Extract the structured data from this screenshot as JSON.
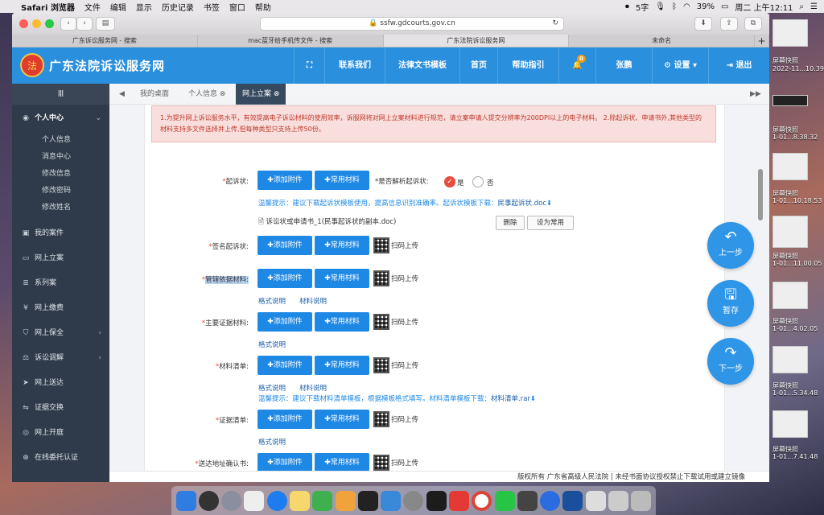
{
  "menubar": {
    "app": "Safari 浏览器",
    "items": [
      "文件",
      "编辑",
      "显示",
      "历史记录",
      "书签",
      "窗口",
      "帮助"
    ],
    "input_method": "5字",
    "battery": "39%",
    "clock": "周二 上午12:11"
  },
  "browser": {
    "url": "ssfw.gdcourts.gov.cn",
    "tabs": [
      {
        "label": "广东诉讼服务网 - 搜索"
      },
      {
        "label": "mac蓝牙给手机传文件 - 搜索"
      },
      {
        "label": "广东法院诉讼服务网"
      },
      {
        "label": "未命名"
      }
    ]
  },
  "site": {
    "title": "广东法院诉讼服务网",
    "logo_glyph": "法",
    "nav": {
      "expand": "⛶",
      "contact": "联系我们",
      "templates": "法律文书模板",
      "home": "首页",
      "help": "帮助指引",
      "bell_badge": "0",
      "user": "张鹏",
      "settings": "设置",
      "logout": "退出"
    }
  },
  "sidebar": {
    "menu_icon": "Ⅲ",
    "personal_center": "个人中心",
    "sub_items": [
      "个人信息",
      "消息中心",
      "修改信息",
      "修改密码",
      "修改姓名"
    ],
    "items": [
      "我的案件",
      "网上立案",
      "系列案",
      "网上缴费",
      "网上保全",
      "诉讼调解",
      "网上送达",
      "证据交换",
      "网上开庭",
      "在线委托认证"
    ]
  },
  "content_tabs": {
    "desk": "我的桌面",
    "personal": "个人信息",
    "filing": "网上立案"
  },
  "form": {
    "notice": "1.为提升网上诉讼服务水平，有效提高电子诉讼材料的使用效率，诉服网将对网上立案材料进行规范，请立案申请人提交分辨率为200DPI以上的电子材料。 2.除起诉状、申请书外,其他类型的材料支持多文件选择并上传,但每种类型只支持上传50份。",
    "add_attachment": "✚添加附件",
    "common_material": "✚常用材料",
    "scan_upload": "扫码上传",
    "format_note": "格式说明",
    "material_note": "材料说明",
    "rows": {
      "complaint": {
        "label": "起诉状:",
        "parse_q": "*是否解析起诉状:",
        "yes": "是",
        "no": "否",
        "tip": "温馨提示：建议下载起诉状模板使用，提高信息识别准确率。起诉状模板下载：",
        "tip_link": "民事起诉状.doc",
        "file": "诉讼状或申请书_1(民事起诉状的副本.doc)",
        "delete": "删除",
        "set_common": "设为常用"
      },
      "signed_complaint": {
        "label": "签名起诉状:"
      },
      "jurisdiction": {
        "label": "管辖依据材料:"
      },
      "main_evidence": {
        "label": "主要证据材料:"
      },
      "material_list": {
        "label": "材料清单:",
        "tip": "温馨提示：建议下载材料清单模板，根据模板格式填写。材料清单模板下载：",
        "tip_link": "材料清单.rar"
      },
      "evidence_list": {
        "label": "证据清单:"
      },
      "service_address": {
        "label": "送达地址确认书:"
      }
    }
  },
  "float_buttons": {
    "prev": "上一步",
    "save": "暂存",
    "next": "下一步"
  },
  "footer": "版权所有 广东省高级人民法院 | 未经书面协议授权禁止下载试用或建立镜像",
  "desktop": {
    "labels": [
      "屏幕快照",
      "2022-11...10.39.36",
      "屏幕快照",
      "1-01...8.38.32",
      "屏幕快照",
      "1-01...10.18.53",
      "屏幕快照",
      "1-01...11.00.05",
      "屏幕快照",
      "1-01...4.02.05",
      "屏幕快照",
      "1-01...5.34.48",
      "屏幕快照",
      "1-01...7.41.48"
    ]
  },
  "colors": {
    "site_blue": "#2a8fdc",
    "sidebar": "#2f3b4a",
    "button_blue": "#1e88e5",
    "notice_red": "#c0392b"
  }
}
